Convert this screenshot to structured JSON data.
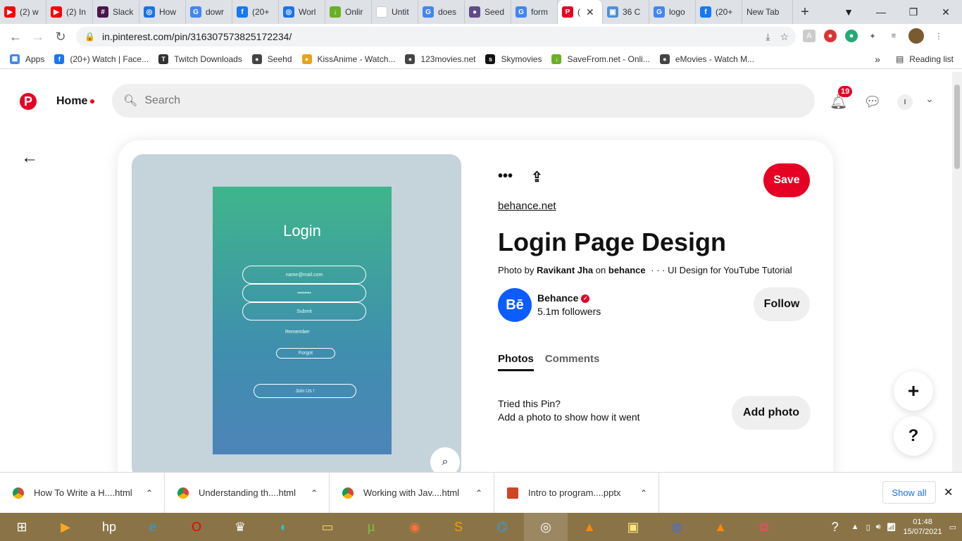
{
  "browser": {
    "tabs": [
      {
        "label": "(2) w",
        "color": "#ff0000",
        "glyph": "▶"
      },
      {
        "label": "(2) In",
        "color": "#ff0000",
        "glyph": "▶"
      },
      {
        "label": "Slack",
        "color": "#4a154b",
        "glyph": "#"
      },
      {
        "label": "How",
        "color": "#1a73e8",
        "glyph": "◎"
      },
      {
        "label": "dowr",
        "color": "#4285f4",
        "glyph": "G"
      },
      {
        "label": "(20+",
        "color": "#1877f2",
        "glyph": "f"
      },
      {
        "label": "Worl",
        "color": "#1a73e8",
        "glyph": "◎"
      },
      {
        "label": "Onlir",
        "color": "#6ab023",
        "glyph": "↓"
      },
      {
        "label": "Untit",
        "color": "#ffffff",
        "glyph": ""
      },
      {
        "label": "does",
        "color": "#4285f4",
        "glyph": "G"
      },
      {
        "label": "Seed",
        "color": "#5f4b8b",
        "glyph": "●"
      },
      {
        "label": "form",
        "color": "#4285f4",
        "glyph": "G"
      },
      {
        "label": "(",
        "color": "#e60023",
        "glyph": "P",
        "active": true
      },
      {
        "label": "36 C",
        "color": "#4a90d9",
        "glyph": "▣"
      },
      {
        "label": "logo",
        "color": "#4285f4",
        "glyph": "G"
      },
      {
        "label": "(20+",
        "color": "#1877f2",
        "glyph": "f"
      },
      {
        "label": "New Tab",
        "color": "",
        "glyph": ""
      }
    ],
    "url": "in.pinterest.com/pin/316307573825172234/",
    "bookmarks": [
      {
        "label": "Apps",
        "color": "#4285f4",
        "glyph": "▦"
      },
      {
        "label": "(20+) Watch | Face...",
        "color": "#1877f2",
        "glyph": "f"
      },
      {
        "label": "Twitch Downloads",
        "color": "#333333",
        "glyph": "T"
      },
      {
        "label": "Seehd",
        "color": "#444444",
        "glyph": "●"
      },
      {
        "label": "KissAnime - Watch...",
        "color": "#e8a317",
        "glyph": "●"
      },
      {
        "label": "123movies.net",
        "color": "#444444",
        "glyph": "●"
      },
      {
        "label": "Skymovies",
        "color": "#111111",
        "glyph": "s"
      },
      {
        "label": "SaveFrom.net - Onli...",
        "color": "#6ab023",
        "glyph": "↓"
      },
      {
        "label": "eMovies - Watch M...",
        "color": "#444444",
        "glyph": "●"
      }
    ],
    "reading_list": "Reading list",
    "more": "»"
  },
  "pinterest": {
    "home_label": "Home",
    "search_placeholder": "Search",
    "notif_count": "19",
    "avatar_initial": "I",
    "pin": {
      "source": "behance.net",
      "title": "Login Page Design",
      "credit_prefix": "Photo by",
      "credit_name": "Ravikant Jha",
      "credit_on": "on",
      "credit_site": "behance",
      "credit_desc": "· · · UI Design for YouTube Tutorial",
      "save_label": "Save",
      "creator_name": "Behance",
      "creator_logo": "Bē",
      "followers": "5.1m followers",
      "follow_label": "Follow",
      "tab_photos": "Photos",
      "tab_comments": "Comments",
      "tried_line1": "Tried this Pin?",
      "tried_line2": "Add a photo to show how it went",
      "add_photo_label": "Add photo"
    },
    "pin_image": {
      "heading": "Login",
      "email_placeholder": "name@mail.com",
      "password_mask": "••••••••",
      "submit": "Submit",
      "remember": "Remember",
      "forgot": "Forgot",
      "join": "Join Us !"
    },
    "fab_plus": "+",
    "fab_help": "?"
  },
  "downloads": {
    "items": [
      "How To Write a H....html",
      "Understanding th....html",
      "Working with Jav....html",
      "Intro to program....pptx"
    ],
    "show_all": "Show all"
  },
  "taskbar": {
    "time": "01:48",
    "date": "15/07/2021"
  }
}
